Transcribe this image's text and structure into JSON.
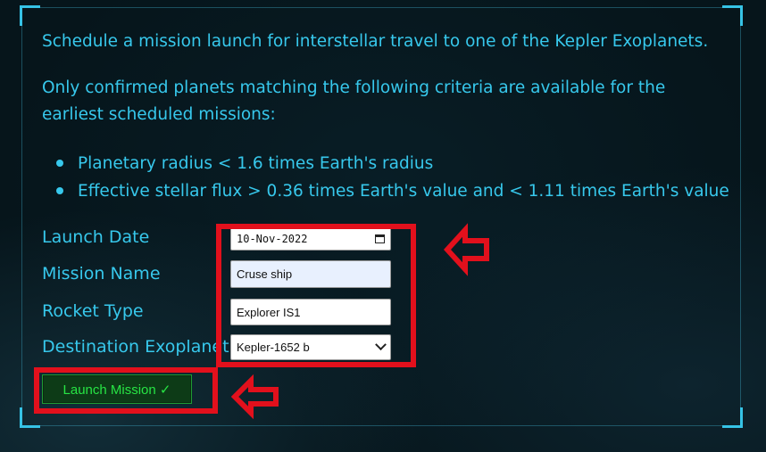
{
  "intro": {
    "text": "Schedule a mission launch for interstellar travel to one of the Kepler Exoplanets."
  },
  "criteria": {
    "text": "Only confirmed planets matching the following criteria are available for the earliest scheduled missions:",
    "items": [
      "Planetary radius < 1.6 times Earth's radius",
      "Effective stellar flux > 0.36 times Earth's value and < 1.11 times Earth's value"
    ]
  },
  "form": {
    "launch_date": {
      "label": "Launch Date",
      "value": "10-Nov-2022"
    },
    "mission_name": {
      "label": "Mission Name",
      "value": "Cruse ship"
    },
    "rocket_type": {
      "label": "Rocket Type",
      "value": "Explorer IS1"
    },
    "destination": {
      "label": "Destination Exoplanet",
      "selected": "Kepler-1652 b"
    },
    "submit_label": "Launch Mission ✓"
  },
  "icons": {
    "calendar": "calendar-icon",
    "dropdown": "chevron-down-icon",
    "annotation_arrow": "left-arrow-icon"
  },
  "colors": {
    "text": "#37c8ec",
    "frame": "#36c3e6",
    "button_text": "#27e444",
    "button_bg": "#0d3b17",
    "highlight": "#e2101c",
    "background": "#06151b"
  }
}
